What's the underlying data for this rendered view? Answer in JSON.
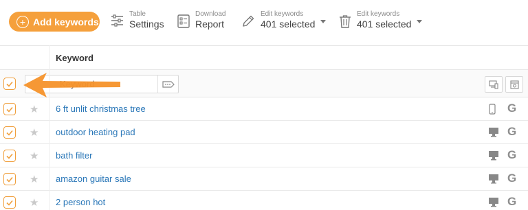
{
  "toolbar": {
    "add_keywords": "Add keywords",
    "table_settings": {
      "small": "Table",
      "big": "Settings"
    },
    "download_report": {
      "small": "Download",
      "big": "Report"
    },
    "edit_keywords_1": {
      "small": "Edit keywords",
      "big": "401 selected"
    },
    "edit_keywords_2": {
      "small": "Edit keywords",
      "big": "401 selected"
    }
  },
  "table": {
    "header_keyword": "Keyword",
    "filter_placeholder": "Keyword",
    "rows": [
      {
        "keyword": "6 ft unlit christmas tree",
        "device": "mobile-icon"
      },
      {
        "keyword": "outdoor heating pad",
        "device": "desktop-icon"
      },
      {
        "keyword": "bath filter",
        "device": "desktop-icon"
      },
      {
        "keyword": "amazon guitar sale",
        "device": "desktop-icon"
      },
      {
        "keyword": "2 person hot",
        "device": "desktop-icon"
      }
    ]
  },
  "colors": {
    "accent": "#f5a03c",
    "link": "#2a77b8",
    "annotation_arrow": "#f5922a"
  }
}
